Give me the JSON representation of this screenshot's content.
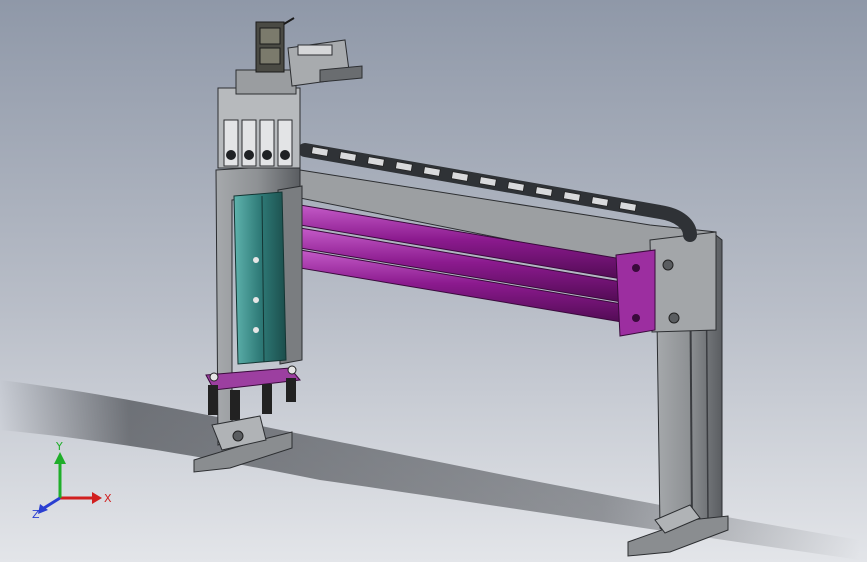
{
  "viewport": {
    "background_top": "#8f98a8",
    "background_bottom": "#e3e5e9"
  },
  "model": {
    "colors": {
      "frame": "#8e9194",
      "frame_dark": "#4a4d51",
      "cylinder": "#8b1a8e",
      "cylinder_highlight": "#c45bc8",
      "slide": "#2f7b78",
      "slide_highlight": "#5fb3ad",
      "chain": "#3c3f43",
      "base_plate_accent": "#9c3fa0"
    },
    "icons": [
      "cable-chain-icon",
      "pneumatic-cylinder-icon",
      "vertical-slide-icon",
      "gripper-icon",
      "valve-bank-icon"
    ]
  },
  "triad": {
    "x_label": "X",
    "y_label": "Y",
    "z_label": "Z",
    "x_color": "#d11f1f",
    "y_color": "#1fae2a",
    "z_color": "#2a3fd1"
  }
}
